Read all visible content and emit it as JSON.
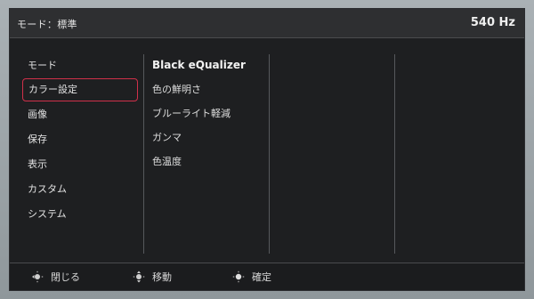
{
  "header": {
    "mode": "モード：標準",
    "refresh_rate": "540 Hz"
  },
  "menu": {
    "items": [
      {
        "label": "モード"
      },
      {
        "label": "カラー設定"
      },
      {
        "label": "画像"
      },
      {
        "label": "保存"
      },
      {
        "label": "表示"
      },
      {
        "label": "カスタム"
      },
      {
        "label": "システム"
      }
    ]
  },
  "submenu": {
    "title": "Black eQualizer",
    "items": [
      {
        "label": "色の鮮明さ"
      },
      {
        "label": "ブルーライト軽減"
      },
      {
        "label": "ガンマ"
      },
      {
        "label": "色温度"
      }
    ]
  },
  "footer": {
    "close": "閉じる",
    "move": "移動",
    "confirm": "確定"
  },
  "colors": {
    "accent_selection": "#d0304a",
    "panel_bg": "#1e1f21"
  },
  "icons": {
    "close": "joystick-left-icon",
    "move": "joystick-updown-icon",
    "confirm": "joystick-press-icon"
  }
}
